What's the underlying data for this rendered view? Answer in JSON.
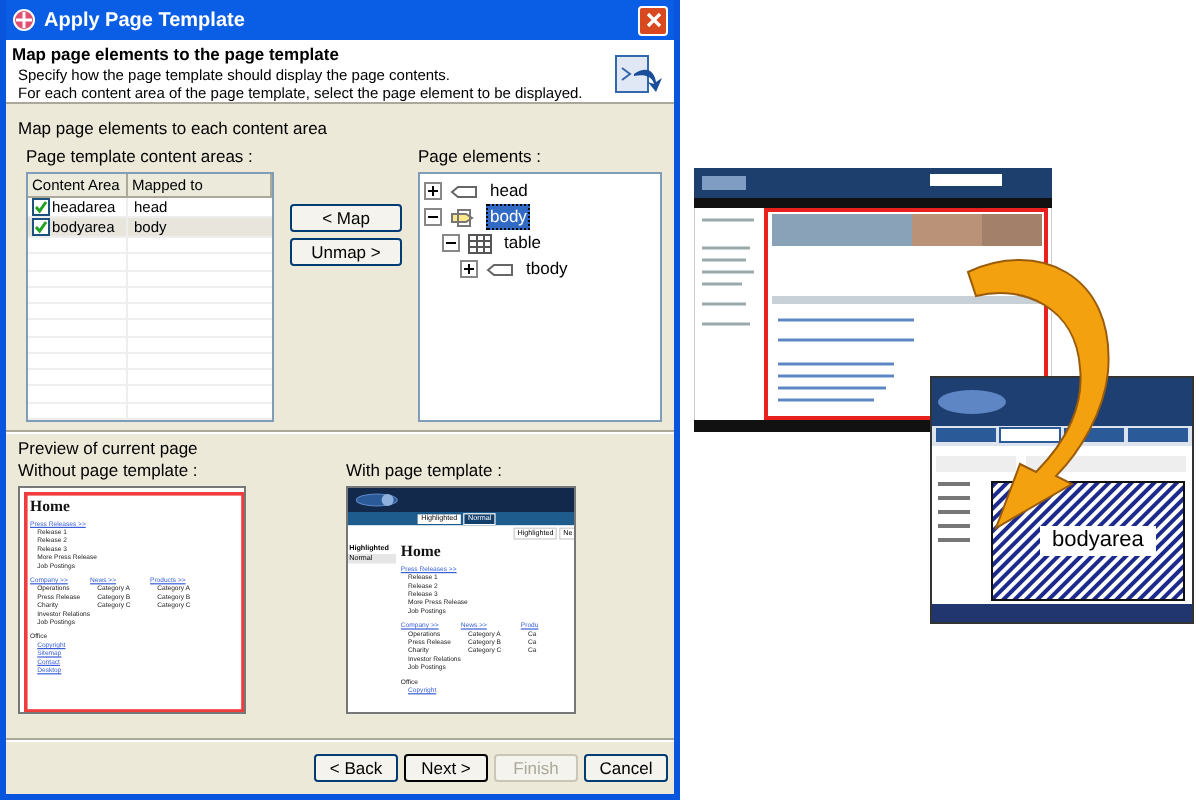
{
  "window": {
    "title": "Apply Page Template"
  },
  "header": {
    "title": "Map page elements to the page template",
    "description": [
      "Specify how the page template should display the page contents.",
      "For each content area of the page template, select the page element to be displayed."
    ]
  },
  "section_label": "Map page elements to each content area",
  "content_areas": {
    "label": "Page template content areas :",
    "columns": [
      "Content Area",
      "Mapped to"
    ],
    "rows": [
      {
        "area": "headarea",
        "mapped_to": "head",
        "checked": true,
        "selected": false
      },
      {
        "area": "bodyarea",
        "mapped_to": "body",
        "checked": true,
        "selected": true
      }
    ]
  },
  "map_buttons": [
    "< Map",
    "Unmap >"
  ],
  "page_elements": {
    "label": "Page elements :",
    "tree": [
      {
        "label": "head",
        "kind": "tag",
        "expanded": false,
        "selected": false
      },
      {
        "label": "body",
        "kind": "body",
        "expanded": true,
        "selected": true,
        "children": [
          {
            "label": "table",
            "kind": "table",
            "expanded": true,
            "selected": false,
            "children": [
              {
                "label": "tbody",
                "kind": "tag",
                "expanded": false,
                "selected": false
              }
            ]
          }
        ]
      }
    ]
  },
  "preview": {
    "title": "Preview of current page",
    "without": {
      "label": "Without page template :",
      "page": {
        "heading": "Home",
        "press_link": "Press Releases >>",
        "press_items": [
          "Release 1",
          "Release 2",
          "Release 3",
          "More Press Release",
          "Job Postings"
        ],
        "columns": [
          {
            "link": "Company >>",
            "items": [
              "Operations",
              "Press Release",
              "Charity",
              "Investor Relations",
              "Job Postings"
            ]
          },
          {
            "link": "News >>",
            "items": [
              "Category A",
              "Category B",
              "Category C"
            ]
          },
          {
            "link": "Products >>",
            "items": [
              "Category A",
              "Category B",
              "Category C"
            ]
          }
        ],
        "office": "Office",
        "office_links": [
          "Copyright",
          "Sitemap",
          "Contact",
          "Desktop"
        ]
      }
    },
    "with": {
      "label": "With page template :",
      "nav_tabs": [
        {
          "label": "Highlighted",
          "selected": false
        },
        {
          "label": "Normal",
          "selected": true
        }
      ],
      "top_tabs": [
        "Highlighted",
        "Ne"
      ],
      "side_items": [
        {
          "label": "Highlighted",
          "selected": false
        },
        {
          "label": "Normal",
          "selected": true
        }
      ],
      "page": {
        "heading": "Home",
        "press_link": "Press Releases >>",
        "press_items": [
          "Release 1",
          "Release 2",
          "Release 3",
          "More Press Release",
          "Job Postings"
        ],
        "columns": [
          {
            "link": "Company >>",
            "items": [
              "Operations",
              "Press Release",
              "Charity",
              "Investor Relations",
              "Job Postings"
            ]
          },
          {
            "link": "News >>",
            "items": [
              "Category A",
              "Category B",
              "Category C"
            ]
          },
          {
            "link": "Produ",
            "items": [
              "Ca",
              "Ca",
              "Ca"
            ]
          }
        ],
        "office": "Office",
        "office_links": [
          "Copyright"
        ]
      }
    }
  },
  "buttons": [
    {
      "label": "< Back",
      "disabled": false,
      "default": false
    },
    {
      "label": "Next >",
      "disabled": false,
      "default": true
    },
    {
      "label": "Finish",
      "disabled": true,
      "default": false
    },
    {
      "label": "Cancel",
      "disabled": false,
      "default": false
    }
  ],
  "illustration": {
    "area_label": "bodyarea"
  }
}
